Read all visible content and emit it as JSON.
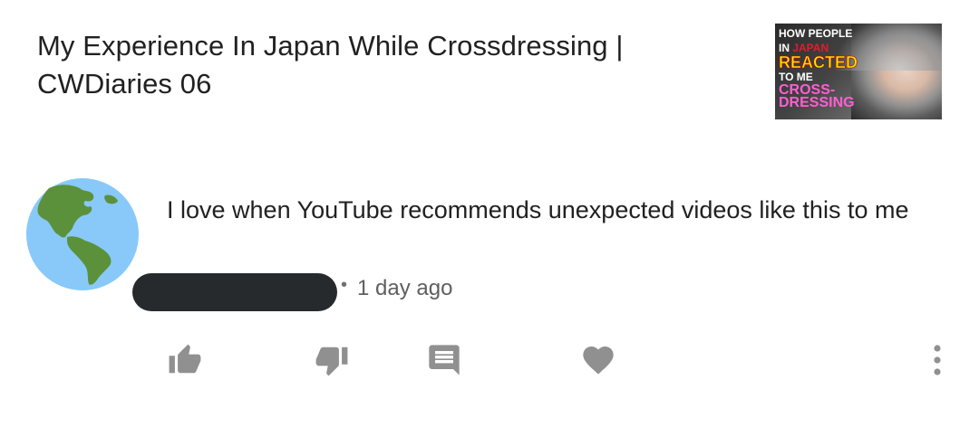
{
  "video": {
    "title": "My Experience In Japan While Crossdressing | CWDiaries 06",
    "thumbnail": {
      "line1": "HOW PEOPLE",
      "line2_prefix": "IN ",
      "line2_highlight": "JAPAN",
      "line3": "REACTED",
      "line4": "TO ME",
      "line5": "CROSS-",
      "line6": "DRESSING"
    }
  },
  "comment": {
    "avatar_icon": "globe-americas-icon",
    "text": "I love when YouTube recommends unexpected videos like this to me",
    "author_redacted": true,
    "separator": "•",
    "timestamp": "1 day ago"
  },
  "actions": {
    "like_icon": "thumbs-up-icon",
    "dislike_icon": "thumbs-down-icon",
    "reply_icon": "reply-comment-icon",
    "heart_icon": "heart-icon",
    "more_icon": "more-vertical-icon",
    "icon_color": "#909090"
  },
  "colors": {
    "globe_ocean": "#88c9f9",
    "globe_land": "#5c913b",
    "redaction": "#262a2d"
  }
}
